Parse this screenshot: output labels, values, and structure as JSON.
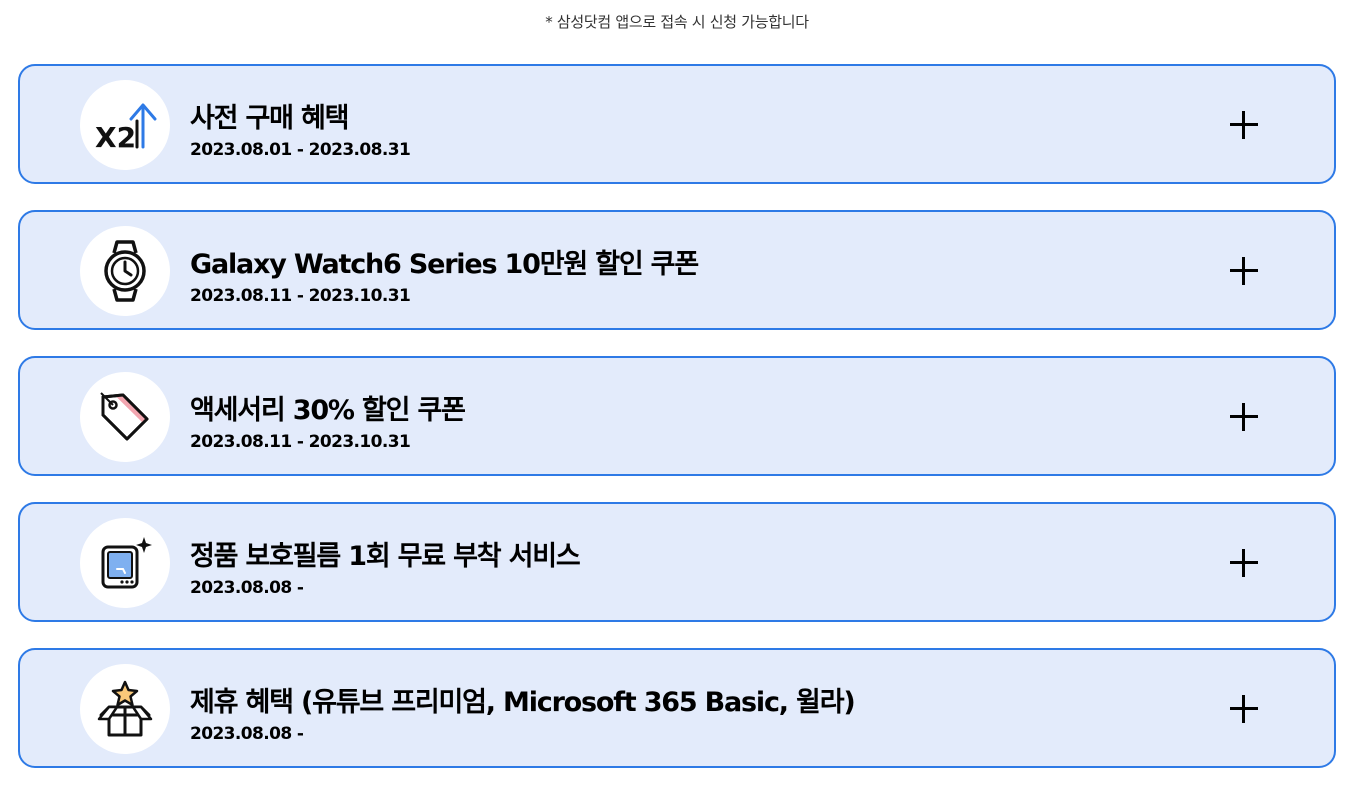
{
  "notice": "* 삼성닷컴 앱으로 접속 시 신청 가능합니다",
  "benefits": [
    {
      "icon": "x2-arrow-up-icon",
      "icon_text": "X2",
      "title": "사전 구매 혜택",
      "date": "2023.08.01 - 2023.08.31"
    },
    {
      "icon": "watch-icon",
      "title": "Galaxy Watch6 Series 10만원 할인 쿠폰",
      "date": "2023.08.11 - 2023.10.31"
    },
    {
      "icon": "price-tag-icon",
      "title": "액세서리 30% 할인 쿠폰",
      "date": "2023.08.11 - 2023.10.31"
    },
    {
      "icon": "tablet-sparkle-icon",
      "title": "정품 보호필름 1회 무료 부착 서비스",
      "date": "2023.08.08 -"
    },
    {
      "icon": "gift-box-star-icon",
      "title": "제휴 혜택 (유튜브 프리미엄, Microsoft 365 Basic, 윌라)",
      "date": "2023.08.08 -"
    }
  ],
  "colors": {
    "card_background": "#e3ebfb",
    "card_border": "#2e7ae6",
    "accent_blue": "#2e7ae6",
    "icon_star_fill": "#f9c97a",
    "icon_tag_stripe": "#f2a6b0"
  }
}
